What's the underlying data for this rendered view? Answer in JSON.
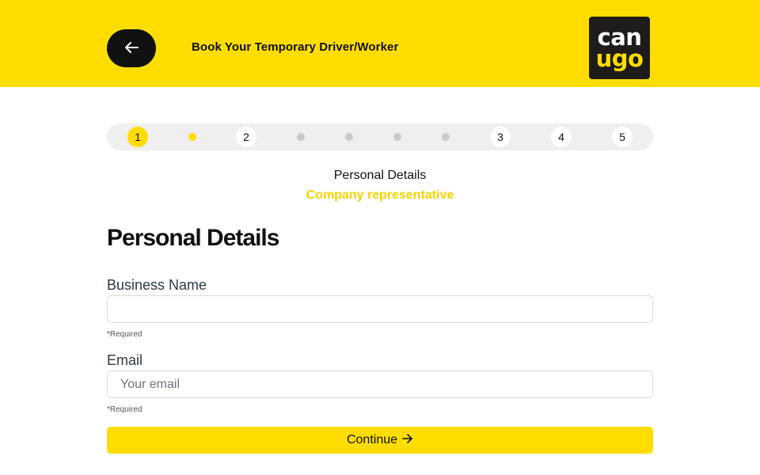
{
  "header": {
    "title": "Book Your Temporary Driver/Worker",
    "back_icon": "arrow-left-icon",
    "logo": {
      "line1": "can",
      "line2": "ugo"
    }
  },
  "colors": {
    "brand_yellow": "#FFDD00",
    "dark": "#111111",
    "inactive_dot": "#C9C9C9"
  },
  "stepper": {
    "numbered_steps": [
      "1",
      "2",
      "3",
      "4",
      "5"
    ],
    "current_step": "1"
  },
  "step_heading": {
    "title": "Personal Details",
    "subtitle": "Company representative"
  },
  "form": {
    "title": "Personal Details",
    "fields": [
      {
        "label": "Business Name",
        "value": "",
        "placeholder": "",
        "hint": "*Required"
      },
      {
        "label": "Email",
        "value": "",
        "placeholder": "Your email",
        "hint": "*Required"
      }
    ],
    "submit_label": "Continue",
    "submit_icon": "arrow-right-icon"
  }
}
